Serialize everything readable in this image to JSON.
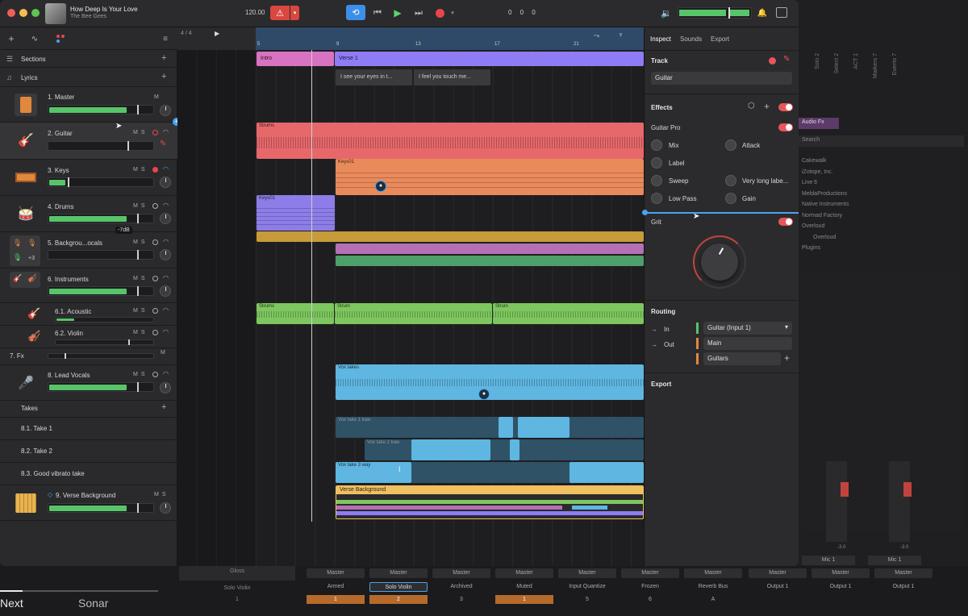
{
  "song": {
    "title": "How Deep Is Your Love",
    "artist": "The Bee Gees"
  },
  "transport": {
    "tempo": "120.00",
    "position": "0 0 0"
  },
  "ruler": {
    "signature": "4 / 4",
    "bars": [
      "5",
      "9",
      "13",
      "17",
      "21"
    ]
  },
  "sections_label": "Sections",
  "lyrics_label": "Lyrics",
  "tracks": [
    {
      "name": "1. Master"
    },
    {
      "name": "2. Guitar"
    },
    {
      "name": "3. Keys"
    },
    {
      "name": "4. Drums",
      "tooltip": "-7dB"
    },
    {
      "name": "5. Backgrou...ocals",
      "badge": "+3"
    },
    {
      "name": "6. Instruments"
    },
    {
      "name": "6.1. Acoustic"
    },
    {
      "name": "6.2. Violin"
    },
    {
      "name": "7. Fx"
    },
    {
      "name": "8. Lead Vocals"
    },
    {
      "name": "9. Verse Background"
    }
  ],
  "takes": {
    "label": "Takes",
    "items": [
      "8.1. Take 1",
      "8.2. Take 2",
      "8.3. Good vibrato take"
    ]
  },
  "msr": {
    "m": "M",
    "s": "S"
  },
  "sections": [
    {
      "label": "Intro"
    },
    {
      "label": "Verse 1"
    }
  ],
  "lyrics": [
    "I see your eyes in t...",
    "I feel you touch me..."
  ],
  "regions": {
    "guitar": "Strums",
    "keys": "Keys01",
    "drums": "Keys01",
    "acoustic1": "Strums",
    "acoustic2": "Strum",
    "acoustic3": "Strum",
    "vox": "Vox takes",
    "take1": "Vox take 1 kaw",
    "take2": "Vox take 2 kaw",
    "take3": "Vox take 3 way",
    "verse_bg": "Verse Background"
  },
  "inspector": {
    "tabs": [
      "Inspect",
      "Sounds",
      "Export"
    ],
    "track_label": "Track",
    "track_name": "Guitar",
    "effects_label": "Effects",
    "plugin_name": "Guitar Pro",
    "params": [
      "Mix",
      "Attack",
      "Label",
      "Sweep",
      "Very long labe...",
      "Low Pass",
      "Gain"
    ],
    "grit_label": "Grit",
    "routing_label": "Routing",
    "in_label": "In",
    "out_label": "Out",
    "input": "Guitar (Input 1)",
    "outputs": [
      "Main",
      "Guitars"
    ],
    "export_label": "Export"
  },
  "bg_mixer": {
    "vendors": [
      "Cakewalk",
      "iZotope, Inc.",
      "Line 6",
      "MeldaProductions",
      "Native Instruments",
      "Normad Factory",
      "Overloud",
      "Overloud"
    ],
    "search": "Search",
    "plugin_tab": "Audio Fx",
    "plugins_label": "Plugins",
    "vertical_labels": [
      "Solo 2",
      "Select 2",
      "ACT 1",
      "Markers 7",
      "Events 7"
    ],
    "mic_labels": [
      "Mic 1",
      "Mic 1"
    ],
    "db_value": "-3.0"
  },
  "bottom": {
    "next": "Next",
    "sonar": "Sonar",
    "gloss": "Gloss",
    "solo_violin_left": "Solo Violin",
    "solo_violin_left_num": "1",
    "channels": [
      {
        "bus": "Master",
        "name": "Armed",
        "num": "1"
      },
      {
        "bus": "Master",
        "name": "Solo Violin",
        "num": "2"
      },
      {
        "bus": "Master",
        "name": "Archived",
        "num": "3"
      },
      {
        "bus": "Master",
        "name": "Muted",
        "num": "1"
      },
      {
        "bus": "Master",
        "name": "Input Quantize",
        "num": "5"
      },
      {
        "bus": "Master",
        "name": "Frozen",
        "num": "6"
      },
      {
        "bus": "Master",
        "name": "Reverb Bus",
        "num": "A"
      },
      {
        "bus": "Master",
        "name": "Output 1",
        "num": ""
      },
      {
        "bus": "Master",
        "name": "Output 1",
        "num": ""
      },
      {
        "bus": "Master",
        "name": "Output 1",
        "num": ""
      }
    ]
  },
  "colors": {
    "intro": "#d873c2",
    "verse": "#8f7cf5",
    "guitar": "#e7686b",
    "keys": "#e98a5b",
    "drums": "#8d7de8",
    "bgv1": "#c79a3a",
    "bgv2": "#b470b5",
    "bgv3": "#4ea06a",
    "acoustic": "#7ec65f",
    "vox": "#5fb6e0",
    "versebg": "#f0c060",
    "accent": "#4aa3f0"
  }
}
